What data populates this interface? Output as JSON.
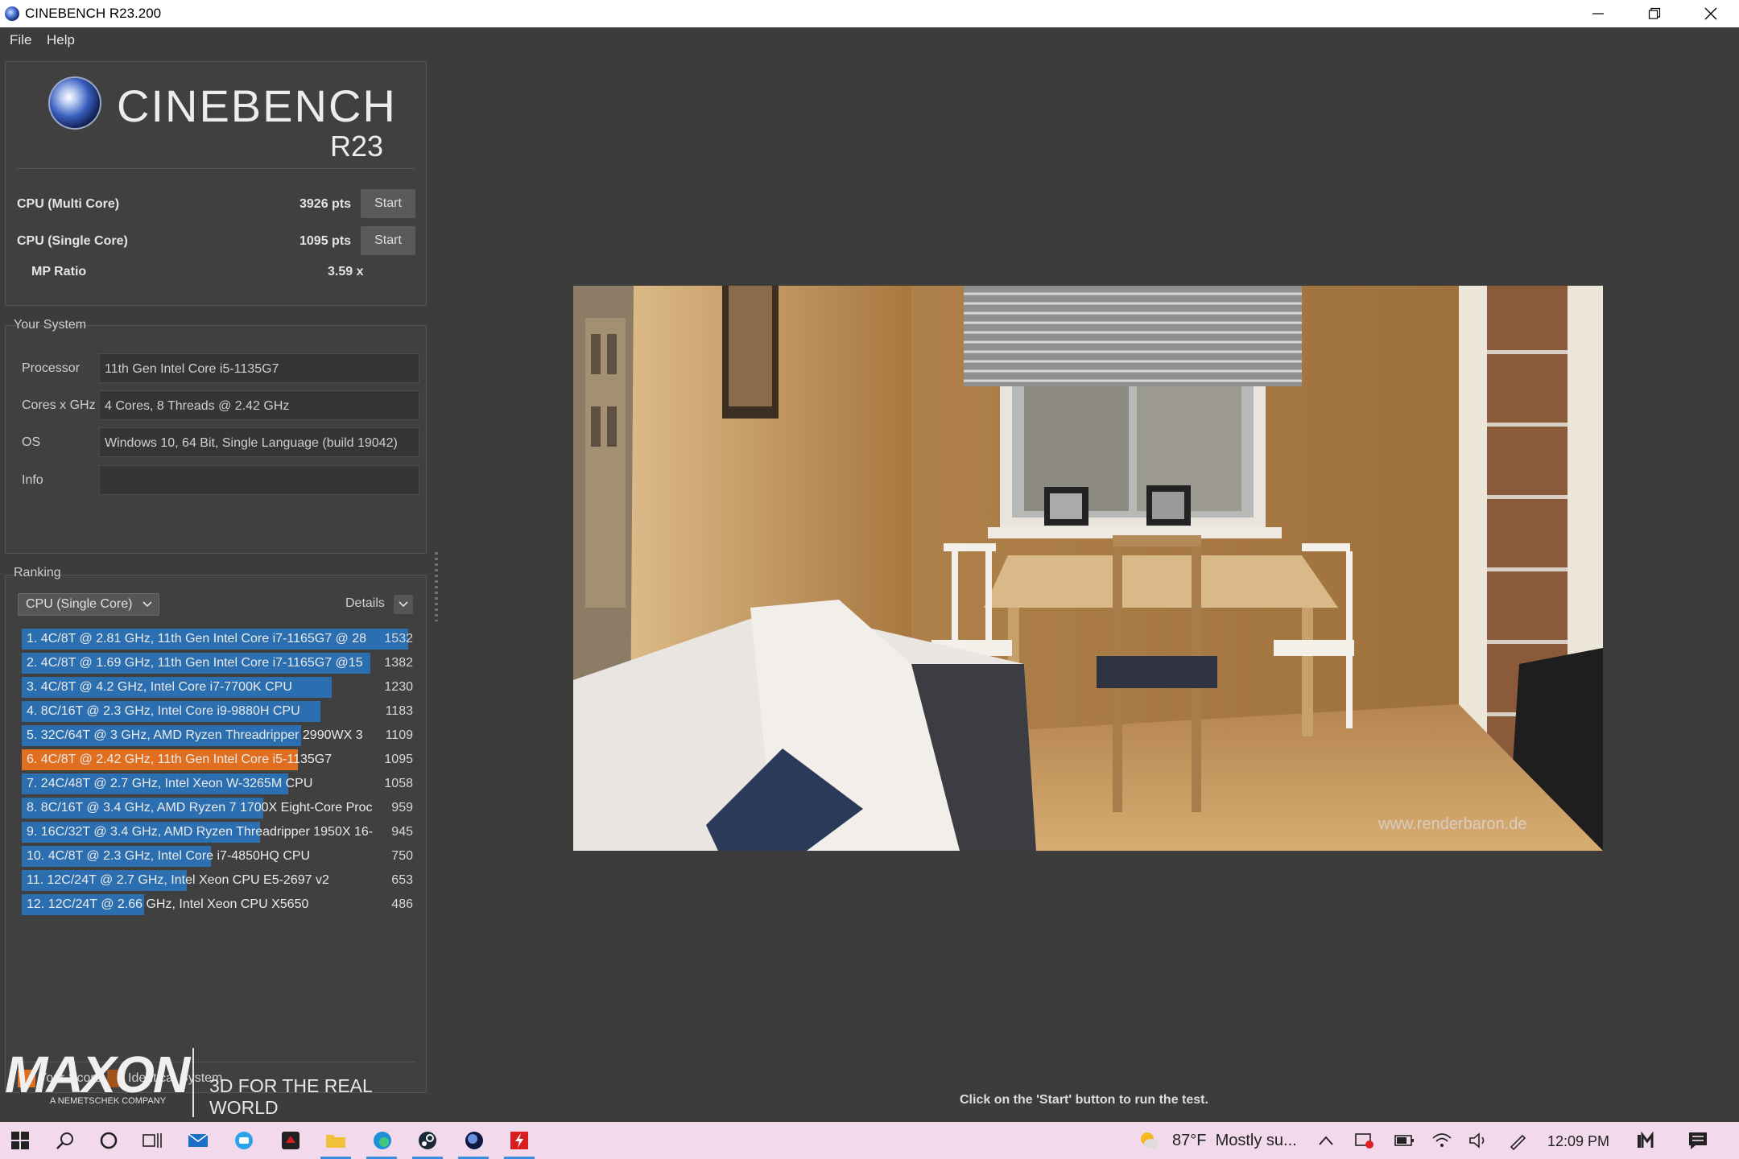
{
  "window": {
    "title": "CINEBENCH R23.200"
  },
  "menu": {
    "file": "File",
    "help": "Help"
  },
  "logo": {
    "name": "CINEBENCH",
    "version": "R23"
  },
  "tests": {
    "multi_label": "CPU (Multi Core)",
    "multi_score": "3926 pts",
    "single_label": "CPU (Single Core)",
    "single_score": "1095 pts",
    "start": "Start",
    "ratio_label": "MP Ratio",
    "ratio_value": "3.59 x"
  },
  "system": {
    "header": "Your System",
    "processor_label": "Processor",
    "processor": "11th Gen Intel Core i5-1135G7",
    "cores_label": "Cores x GHz",
    "cores": "4 Cores, 8 Threads @ 2.42 GHz",
    "os_label": "OS",
    "os": "Windows 10, 64 Bit, Single Language (build 19042)",
    "info_label": "Info",
    "info": ""
  },
  "ranking": {
    "header": "Ranking",
    "dropdown": "CPU (Single Core)",
    "details": "Details",
    "max_score": 1532,
    "rows": [
      {
        "label": "1. 4C/8T @ 2.81 GHz, 11th Gen Intel Core i7-1165G7 @ 28",
        "score": "1532",
        "value": 1532,
        "mine": false
      },
      {
        "label": "2. 4C/8T @ 1.69 GHz, 11th Gen Intel Core i7-1165G7 @15",
        "score": "1382",
        "value": 1382,
        "mine": false
      },
      {
        "label": "3. 4C/8T @ 4.2 GHz, Intel Core i7-7700K CPU",
        "score": "1230",
        "value": 1230,
        "mine": false
      },
      {
        "label": "4. 8C/16T @ 2.3 GHz, Intel Core i9-9880H CPU",
        "score": "1183",
        "value": 1183,
        "mine": false
      },
      {
        "label": "5. 32C/64T @ 3 GHz, AMD Ryzen Threadripper 2990WX 3",
        "score": "1109",
        "value": 1109,
        "mine": false
      },
      {
        "label": "6. 4C/8T @ 2.42 GHz, 11th Gen Intel Core i5-1135G7",
        "score": "1095",
        "value": 1095,
        "mine": true
      },
      {
        "label": "7. 24C/48T @ 2.7 GHz, Intel Xeon W-3265M CPU",
        "score": "1058",
        "value": 1058,
        "mine": false
      },
      {
        "label": "8. 8C/16T @ 3.4 GHz, AMD Ryzen 7 1700X Eight-Core Proc",
        "score": "959",
        "value": 959,
        "mine": false
      },
      {
        "label": "9. 16C/32T @ 3.4 GHz, AMD Ryzen Threadripper 1950X 16-",
        "score": "945",
        "value": 945,
        "mine": false
      },
      {
        "label": "10. 4C/8T @ 2.3 GHz, Intel Core i7-4850HQ CPU",
        "score": "750",
        "value": 750,
        "mine": false
      },
      {
        "label": "11. 12C/24T @ 2.7 GHz, Intel Xeon CPU E5-2697 v2",
        "score": "653",
        "value": 653,
        "mine": false
      },
      {
        "label": "12. 12C/24T @ 2.66 GHz, Intel Xeon CPU X5650",
        "score": "486",
        "value": 486,
        "mine": false
      }
    ],
    "legend_your": "Your Score",
    "legend_identical": "Identical System"
  },
  "footer": {
    "brand": "MAXON",
    "brand_sub": "A NEMETSCHEK COMPANY",
    "slogan": "3D FOR THE REAL WORLD",
    "hint": "Click on the 'Start' button to run the test."
  },
  "render": {
    "watermark": "www.renderbaron.de"
  },
  "taskbar": {
    "weather": "87°F  Mostly su...",
    "time": "12:09 PM"
  },
  "colors": {
    "bar": "#2c6fb0",
    "mine": "#e07020",
    "identical": "#a0521a"
  }
}
